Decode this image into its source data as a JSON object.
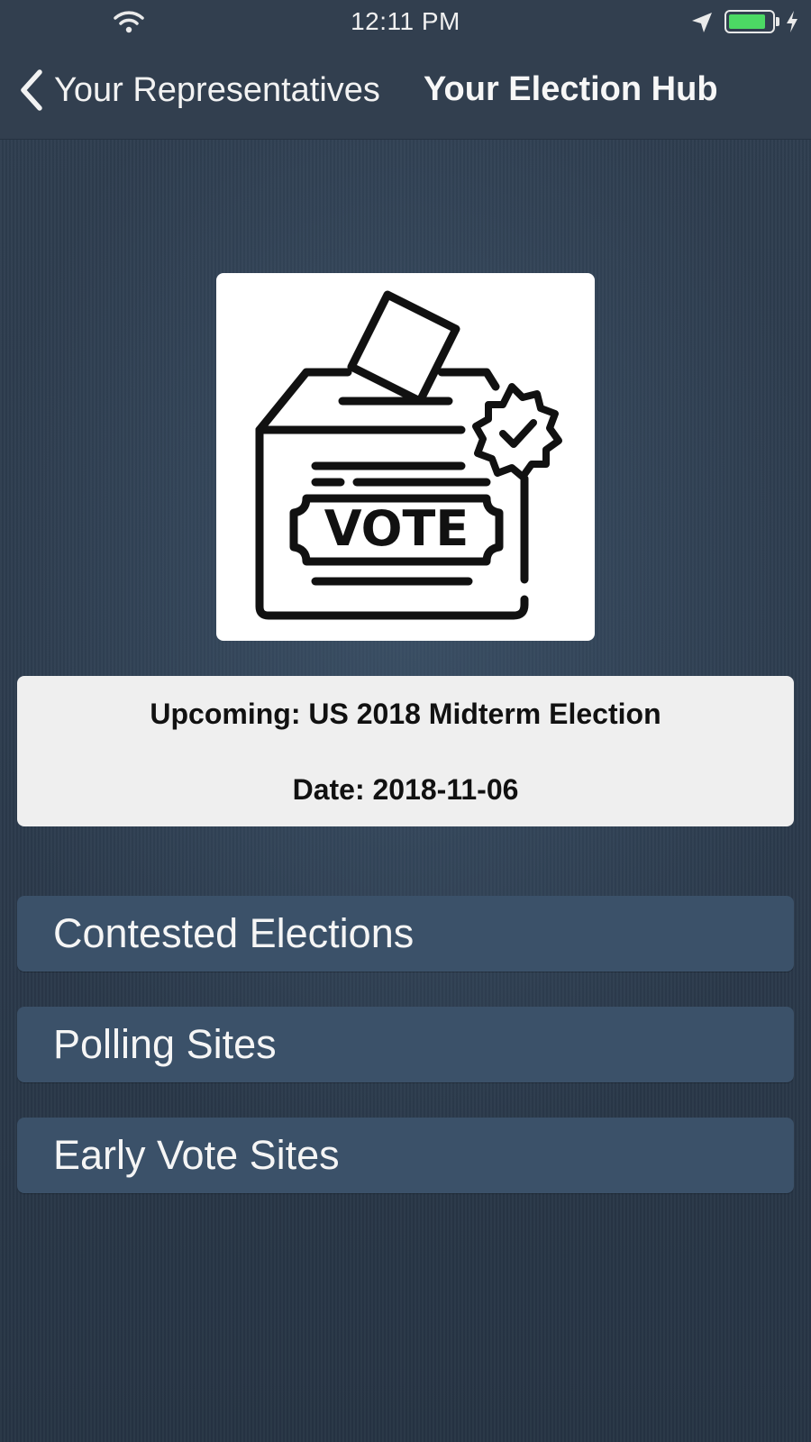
{
  "status_bar": {
    "time": "12:11 PM",
    "battery_level_percent": 88,
    "battery_color": "#4cd964",
    "icons": [
      "wifi-icon",
      "location-arrow-icon",
      "battery-icon",
      "charging-bolt-icon"
    ]
  },
  "nav": {
    "back_label": "Your Representatives",
    "back_icon": "chevron-left-icon",
    "title": "Your Election Hub"
  },
  "hero": {
    "icon": "ballot-box-vote-icon",
    "image_text": "VOTE"
  },
  "election": {
    "name": "Upcoming: US 2018 Midterm Election",
    "date": "Date: 2018-11-06"
  },
  "menu": {
    "items": [
      {
        "label": "Contested Elections"
      },
      {
        "label": "Polling Sites"
      },
      {
        "label": "Early Vote Sites"
      }
    ]
  },
  "colors": {
    "nav_background": "#323f4f",
    "page_background": "#2b3a4c",
    "menu_button": "#3b5169",
    "card_background": "#efefef"
  }
}
